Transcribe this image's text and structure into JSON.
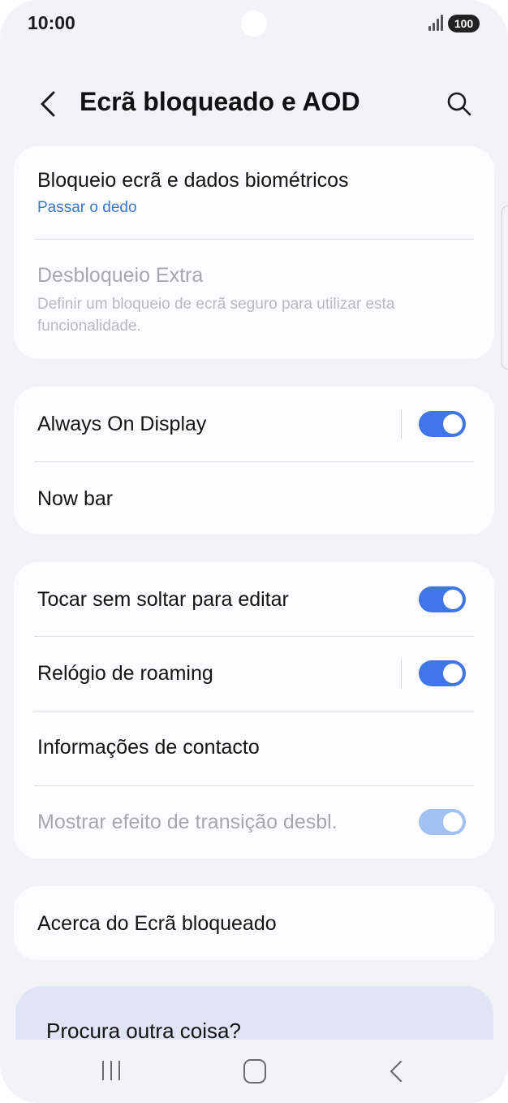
{
  "status_bar": {
    "time": "10:00",
    "battery": "100"
  },
  "header": {
    "title": "Ecrã bloqueado e AOD"
  },
  "card1": {
    "lock_screen": {
      "label": "Bloqueio ecrã e dados biométricos",
      "value": "Passar o dedo"
    },
    "extra_unlock": {
      "label": "Desbloqueio Extra",
      "description": "Definir um bloqueio de ecrã seguro para utilizar esta funcionalidade."
    }
  },
  "card2": {
    "always_on_display": {
      "label": "Always On Display",
      "enabled": true
    },
    "now_bar": {
      "label": "Now bar"
    }
  },
  "card3": {
    "touch_hold_edit": {
      "label": "Tocar sem soltar para editar",
      "enabled": true
    },
    "roaming_clock": {
      "label": "Relógio de roaming",
      "enabled": true
    },
    "contact_info": {
      "label": "Informações de contacto"
    },
    "unlock_transition": {
      "label": "Mostrar efeito de transição desbl.",
      "enabled": true,
      "disabled": true
    }
  },
  "card4": {
    "about": {
      "label": "Acerca do Ecrã bloqueado"
    }
  },
  "suggest": {
    "label": "Procura outra coisa?"
  },
  "colors": {
    "accent": "#3f75e6",
    "link": "#3a78d0",
    "background": "#f3f2f7",
    "card": "#fcfcff"
  },
  "icons": [
    "back-arrow-icon",
    "search-icon",
    "recent-apps-icon",
    "home-icon",
    "nav-back-icon"
  ]
}
